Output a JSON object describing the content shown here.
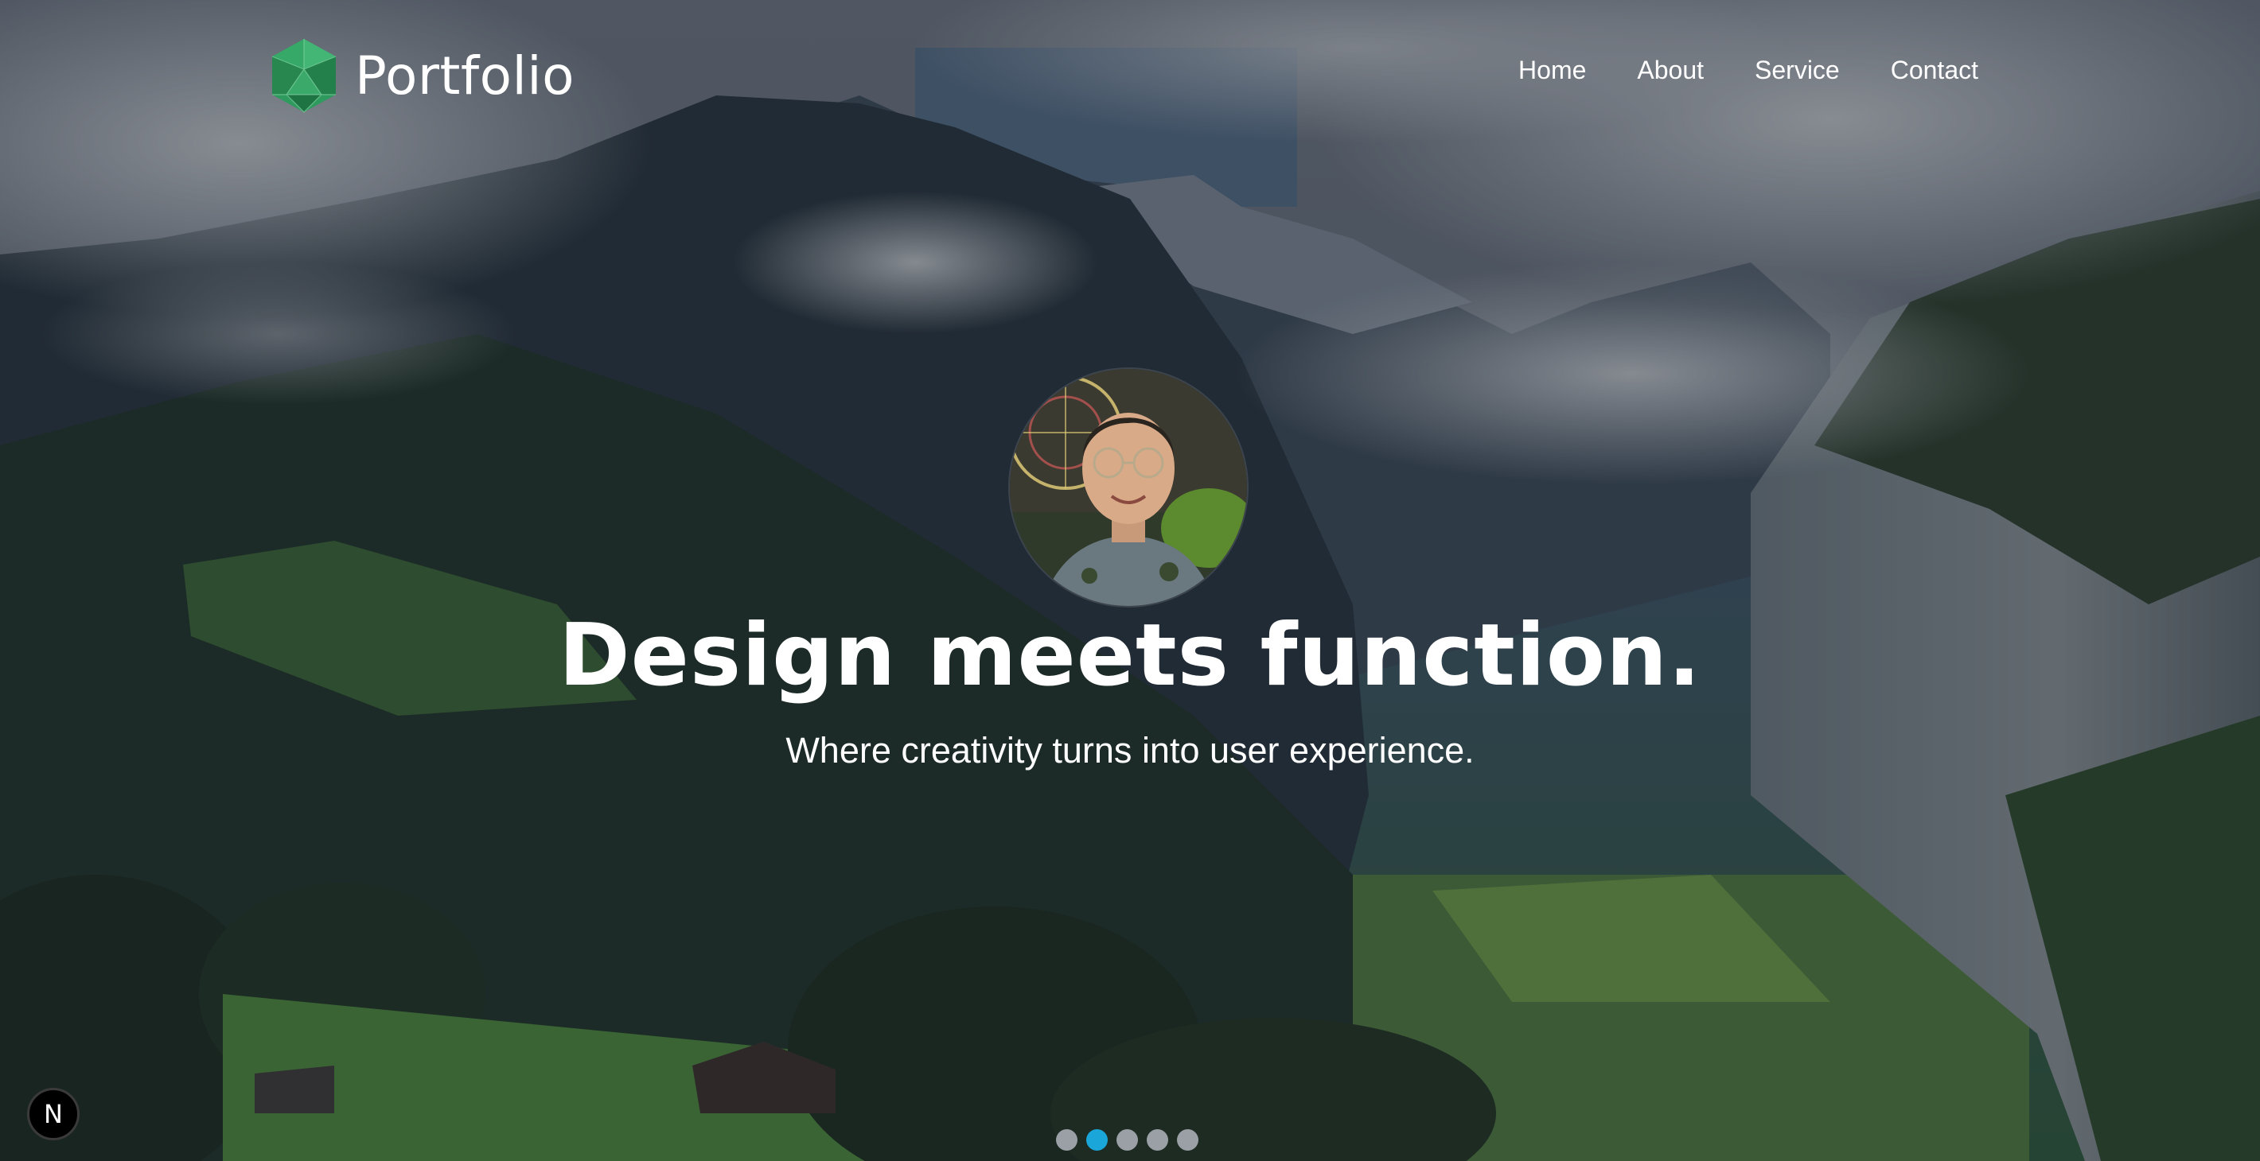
{
  "brand": {
    "logo_icon": "green-polyhedron-logo-icon",
    "name": "Portfolio"
  },
  "nav": {
    "items": [
      {
        "label": "Home"
      },
      {
        "label": "About"
      },
      {
        "label": "Service"
      },
      {
        "label": "Contact"
      }
    ]
  },
  "hero": {
    "background": "mountain-valley-photo",
    "avatar": "profile-photo",
    "headline": "Design meets function.",
    "subline": "Where creativity turns into user experience."
  },
  "slider": {
    "count": 5,
    "active_index": 1
  },
  "dev_badge": {
    "letter": "N",
    "icon": "nextjs-badge-icon"
  },
  "colors": {
    "logo_green": "#2e9a5e",
    "dot_active": "#1aa6d8",
    "dot_inactive": "#9aa0a6",
    "text": "#ffffff"
  }
}
